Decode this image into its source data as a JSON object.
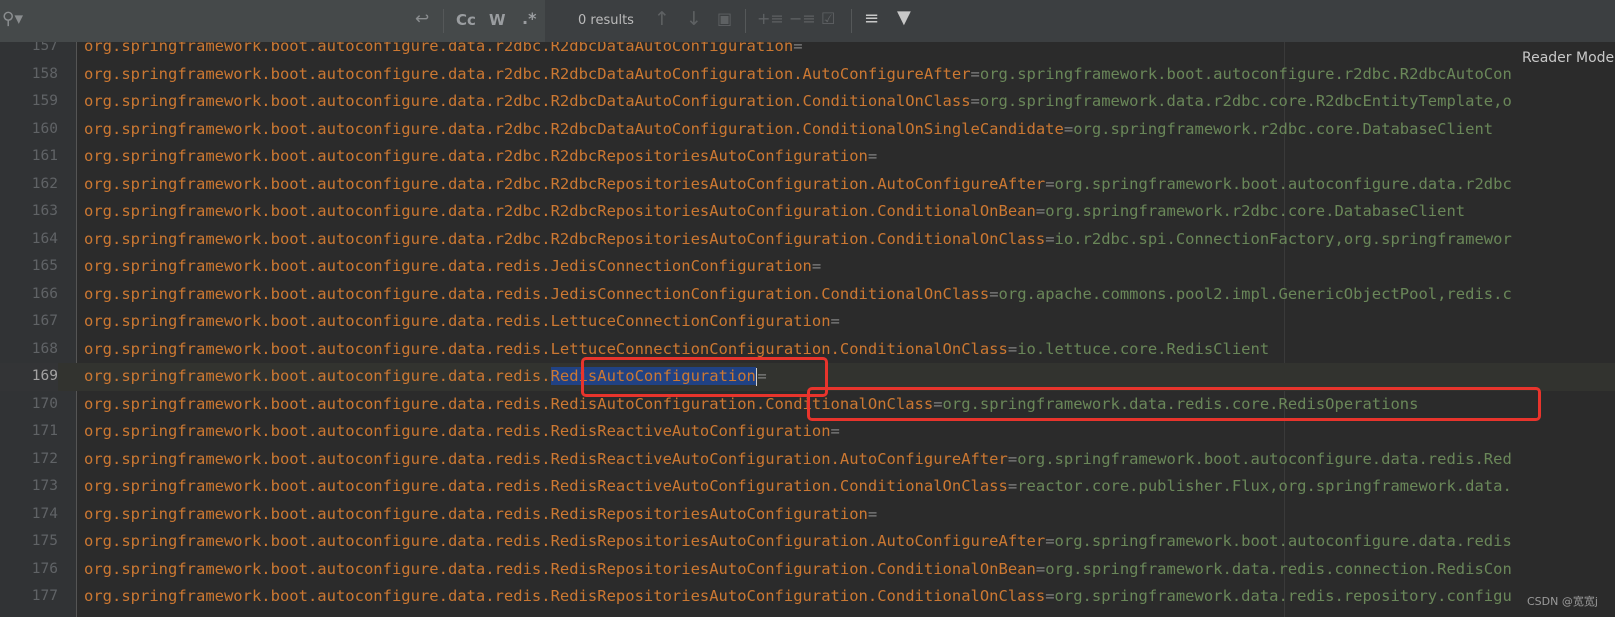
{
  "toolbar": {
    "search_value": "",
    "search_icon": "search-icon",
    "wrap_icon": "wrap-icon",
    "match_case_label": "Cc",
    "whole_words_label": "W",
    "regex_label": ".*",
    "results_text": "0 results",
    "prev_icon": "arrow-up-icon",
    "next_icon": "arrow-down-icon",
    "filter_icon": "filter-icon"
  },
  "editor": {
    "reader_mode_label": "Reader Mode",
    "lines": [
      {
        "num": "157",
        "key": "org.springframework.boot.autoconfigure.data.r2dbc.R2dbcDataAutoConfiguration",
        "value": ""
      },
      {
        "num": "158",
        "key": "org.springframework.boot.autoconfigure.data.r2dbc.R2dbcDataAutoConfiguration.AutoConfigureAfter",
        "value": "org.springframework.boot.autoconfigure.r2dbc.R2dbcAutoCon"
      },
      {
        "num": "159",
        "key": "org.springframework.boot.autoconfigure.data.r2dbc.R2dbcDataAutoConfiguration.ConditionalOnClass",
        "value": "org.springframework.data.r2dbc.core.R2dbcEntityTemplate,o"
      },
      {
        "num": "160",
        "key": "org.springframework.boot.autoconfigure.data.r2dbc.R2dbcDataAutoConfiguration.ConditionalOnSingleCandidate",
        "value": "org.springframework.r2dbc.core.DatabaseClient"
      },
      {
        "num": "161",
        "key": "org.springframework.boot.autoconfigure.data.r2dbc.R2dbcRepositoriesAutoConfiguration",
        "value": ""
      },
      {
        "num": "162",
        "key": "org.springframework.boot.autoconfigure.data.r2dbc.R2dbcRepositoriesAutoConfiguration.AutoConfigureAfter",
        "value": "org.springframework.boot.autoconfigure.data.r2dbc"
      },
      {
        "num": "163",
        "key": "org.springframework.boot.autoconfigure.data.r2dbc.R2dbcRepositoriesAutoConfiguration.ConditionalOnBean",
        "value": "org.springframework.r2dbc.core.DatabaseClient"
      },
      {
        "num": "164",
        "key": "org.springframework.boot.autoconfigure.data.r2dbc.R2dbcRepositoriesAutoConfiguration.ConditionalOnClass",
        "value": "io.r2dbc.spi.ConnectionFactory,org.springframewor"
      },
      {
        "num": "165",
        "key": "org.springframework.boot.autoconfigure.data.redis.JedisConnectionConfiguration",
        "value": ""
      },
      {
        "num": "166",
        "key": "org.springframework.boot.autoconfigure.data.redis.JedisConnectionConfiguration.ConditionalOnClass",
        "value": "org.apache.commons.pool2.impl.GenericObjectPool,redis.c"
      },
      {
        "num": "167",
        "key": "org.springframework.boot.autoconfigure.data.redis.LettuceConnectionConfiguration",
        "value": ""
      },
      {
        "num": "168",
        "key": "org.springframework.boot.autoconfigure.data.redis.LettuceConnectionConfiguration.ConditionalOnClass",
        "value": "io.lettuce.core.RedisClient"
      },
      {
        "num": "169",
        "key_prefix": "org.springframework.boot.autoconfigure.data.redis.",
        "key_selected": "RedisAutoConfiguration",
        "value": ""
      },
      {
        "num": "170",
        "key": "org.springframework.boot.autoconfigure.data.redis.RedisAutoConfiguration.ConditionalOnClass",
        "value": "org.springframework.data.redis.core.RedisOperations"
      },
      {
        "num": "171",
        "key": "org.springframework.boot.autoconfigure.data.redis.RedisReactiveAutoConfiguration",
        "value": ""
      },
      {
        "num": "172",
        "key": "org.springframework.boot.autoconfigure.data.redis.RedisReactiveAutoConfiguration.AutoConfigureAfter",
        "value": "org.springframework.boot.autoconfigure.data.redis.Red"
      },
      {
        "num": "173",
        "key": "org.springframework.boot.autoconfigure.data.redis.RedisReactiveAutoConfiguration.ConditionalOnClass",
        "value": "reactor.core.publisher.Flux,org.springframework.data."
      },
      {
        "num": "174",
        "key": "org.springframework.boot.autoconfigure.data.redis.RedisRepositoriesAutoConfiguration",
        "value": ""
      },
      {
        "num": "175",
        "key": "org.springframework.boot.autoconfigure.data.redis.RedisRepositoriesAutoConfiguration.AutoConfigureAfter",
        "value": "org.springframework.boot.autoconfigure.data.redis"
      },
      {
        "num": "176",
        "key": "org.springframework.boot.autoconfigure.data.redis.RedisRepositoriesAutoConfiguration.ConditionalOnBean",
        "value": "org.springframework.data.redis.connection.RedisCon"
      },
      {
        "num": "177",
        "key": "org.springframework.boot.autoconfigure.data.redis.RedisRepositoriesAutoConfiguration.ConditionalOnClass",
        "value": "org.springframework.data.redis.repository.configu"
      }
    ]
  },
  "watermark": "CSDN @宽宽j"
}
